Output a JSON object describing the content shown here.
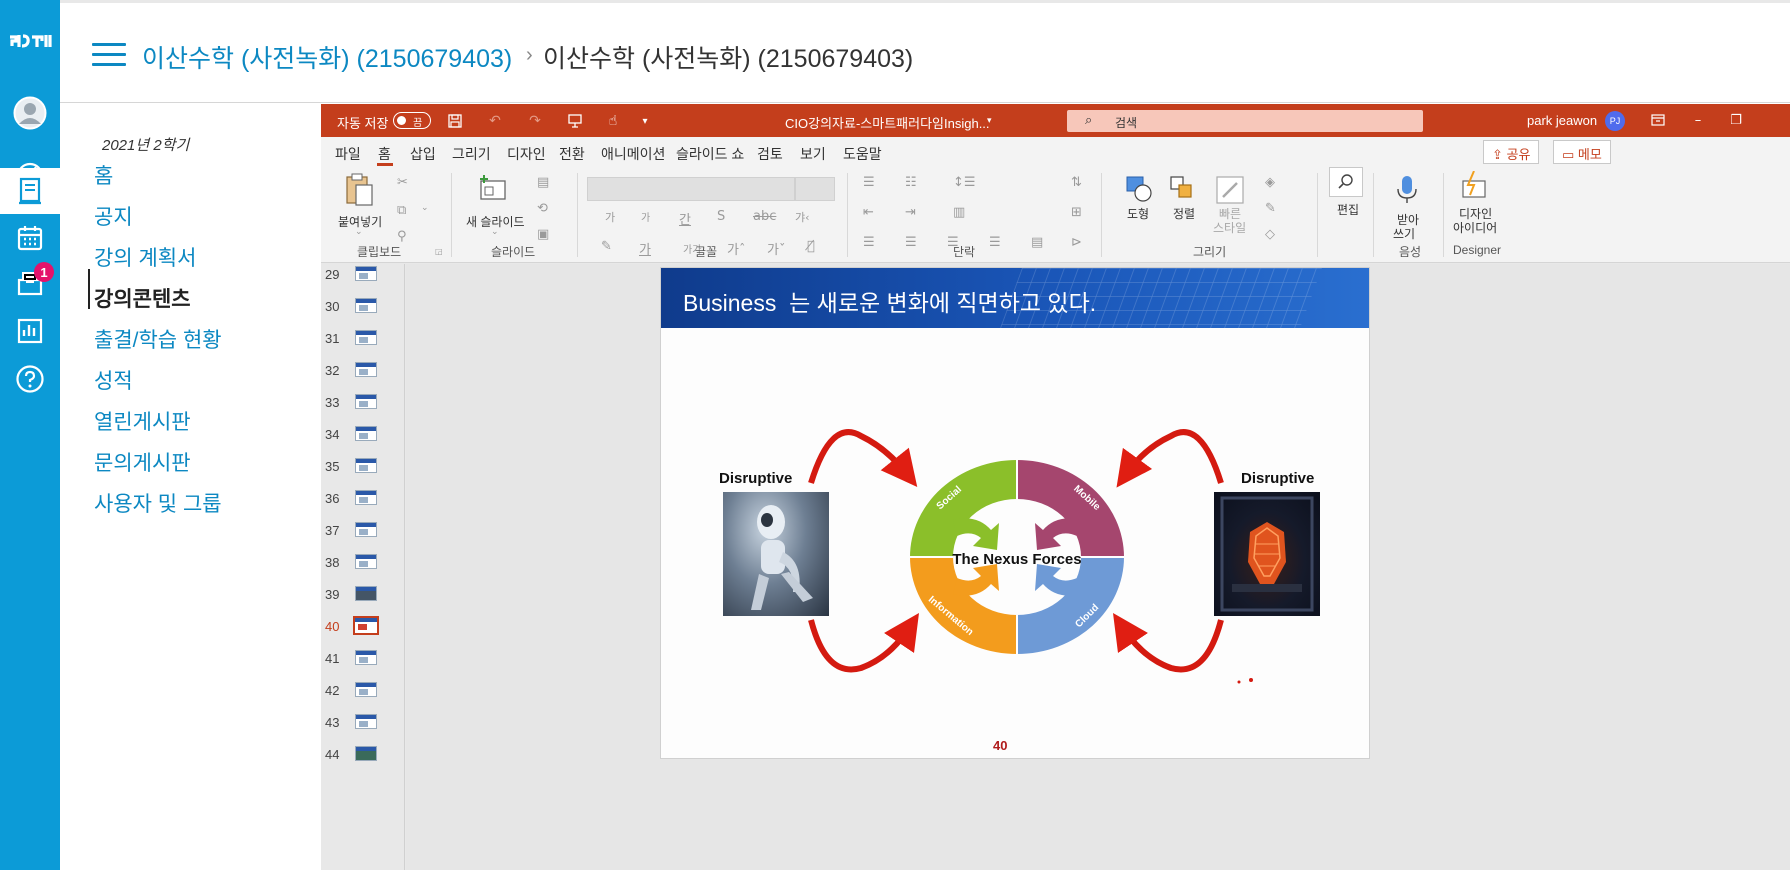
{
  "rail": {
    "logo": "ಽ௰",
    "notification_count": "1"
  },
  "header": {
    "course_link": "이산수학 (사전녹화) (2150679403)",
    "separator": "›",
    "current": "이산수학 (사전녹화) (2150679403)"
  },
  "course_nav": {
    "term": "2021년 2학기",
    "items": [
      {
        "label": "홈"
      },
      {
        "label": "공지"
      },
      {
        "label": "강의 계획서"
      },
      {
        "label": "강의콘텐츠"
      },
      {
        "label": "출결/학습 현황"
      },
      {
        "label": "성적"
      },
      {
        "label": "열린게시판"
      },
      {
        "label": "문의게시판"
      },
      {
        "label": "사용자 및 그룹"
      }
    ]
  },
  "ppt": {
    "autosave_label": "자동 저장",
    "autosave_state": "끔",
    "doc_title": "CIO강의자료-스마트패러다임Insigh...",
    "search_placeholder": "검색",
    "user_name": "park jeawon",
    "user_initials": "PJ",
    "tabs": [
      "파일",
      "홈",
      "삽입",
      "그리기",
      "디자인",
      "전환",
      "애니메이션",
      "슬라이드 쇼",
      "검토",
      "보기",
      "도움말"
    ],
    "share_label": "공유",
    "memo_label": "메모",
    "ribbon": {
      "paste": "붙여넣기",
      "new_slide": "새 슬라이드",
      "shapes": "도형",
      "arrange": "정렬",
      "quick_styles_1": "빠른",
      "quick_styles_2": "스타일",
      "editing": "편집",
      "dictate_1": "받아",
      "dictate_2": "쓰기",
      "designer_1": "디자인",
      "designer_2": "아이디어",
      "groups": {
        "clipboard": "클립보드",
        "slides": "슬라이드",
        "font": "글꼴",
        "paragraph": "단락",
        "drawing": "그리기",
        "voice": "음성",
        "designer": "Designer"
      }
    },
    "thumbnails": [
      "29",
      "30",
      "31",
      "32",
      "33",
      "34",
      "35",
      "36",
      "37",
      "38",
      "39",
      "40",
      "41",
      "42",
      "43",
      "44"
    ],
    "current_slide": "40",
    "slide": {
      "title_en": "Business",
      "title_ko": "는 새로운 변화에 직면하고 있다.",
      "left_label": "Disruptive",
      "right_label": "Disruptive",
      "center_label": "The Nexus Forces",
      "seg_social": "Social",
      "seg_mobile": "Mobile",
      "seg_information": "Information",
      "seg_cloud": "Cloud",
      "page_number": "40"
    }
  },
  "colors": {
    "rail": "#0c9bd7",
    "link": "#0c88c2",
    "ppt_accent": "#c43e1c",
    "slide_header": "#1a56b8",
    "social": "#8bbf2a",
    "mobile": "#a5466e",
    "information": "#f39c1d",
    "cloud": "#6e9ad6"
  }
}
